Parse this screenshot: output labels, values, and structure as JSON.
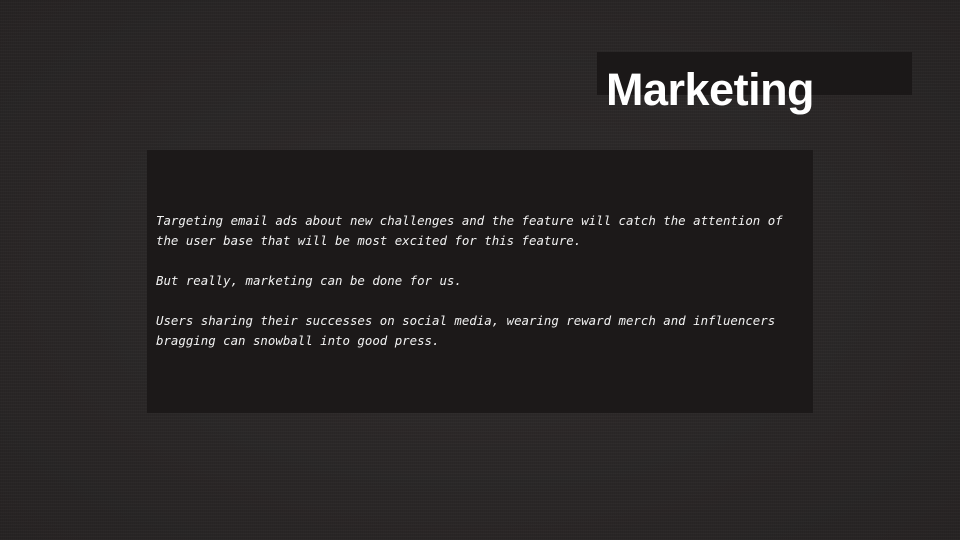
{
  "slide": {
    "title": "Marketing",
    "paragraphs": [
      "Targeting email ads about new challenges and the feature will catch the attention of the user base that will be most excited for this feature.",
      "But really, marketing can be done for us.",
      "Users sharing their successes on social media, wearing reward merch and influencers bragging can snowball into good press."
    ]
  }
}
